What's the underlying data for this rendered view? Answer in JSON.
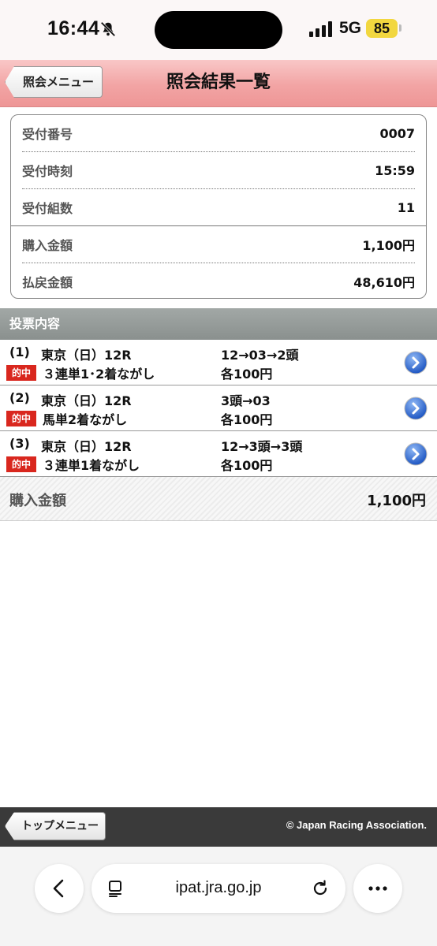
{
  "status_bar": {
    "time": "16:44",
    "network": "5G",
    "battery": "85"
  },
  "header": {
    "back_label": "照会メニュー",
    "title": "照会結果一覧"
  },
  "summary": [
    {
      "label": "受付番号",
      "value": "0007"
    },
    {
      "label": "受付時刻",
      "value": "15:59"
    },
    {
      "label": "受付組数",
      "value": "11"
    },
    {
      "label": "購入金額",
      "value": "1,100円"
    },
    {
      "label": "払戻金額",
      "value": "48,610円"
    }
  ],
  "section_title": "投票内容",
  "bets": [
    {
      "num": "(1)",
      "venue": "東京（日）12R",
      "combo": "12→03→2頭",
      "badge": "的中",
      "type": "３連単1･2着ながし",
      "amount": "各100円"
    },
    {
      "num": "(2)",
      "venue": "東京（日）12R",
      "combo": "3頭→03",
      "badge": "的中",
      "type": "馬単2着ながし",
      "amount": "各100円"
    },
    {
      "num": "(3)",
      "venue": "東京（日）12R",
      "combo": "12→3頭→3頭",
      "badge": "的中",
      "type": "３連単1着ながし",
      "amount": "各100円"
    }
  ],
  "total": {
    "label": "購入金額",
    "value": "1,100円"
  },
  "footer": {
    "top_label": "トップメニュー",
    "copyright": "© Japan Racing Association."
  },
  "browser": {
    "url": "ipat.jra.go.jp"
  },
  "colors": {
    "header_pink": "#f2a4a4",
    "hit_red": "#d9271e",
    "detail_blue": "#2f6fd6"
  }
}
